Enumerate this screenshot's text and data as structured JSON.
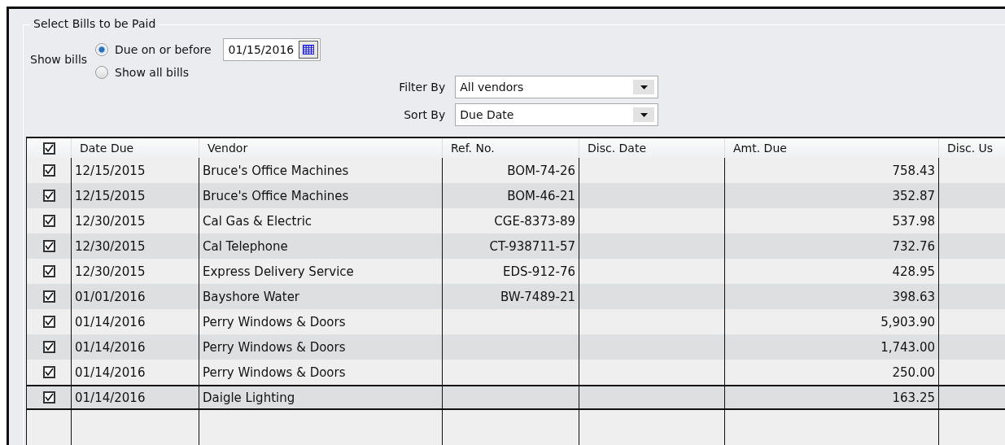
{
  "group_title": "Select Bills to be Paid",
  "show_bills": {
    "label": "Show bills",
    "options": [
      {
        "label": "Due on or before",
        "selected": true
      },
      {
        "label": "Show all bills",
        "selected": false
      }
    ],
    "date": "01/15/2016"
  },
  "filter_by": {
    "label": "Filter By",
    "value": "All vendors"
  },
  "sort_by": {
    "label": "Sort By",
    "value": "Due Date"
  },
  "table": {
    "header_checked": true,
    "columns": [
      "Date Due",
      "Vendor",
      "Ref. No.",
      "Disc. Date",
      "Amt. Due",
      "Disc. Us"
    ],
    "rows": [
      {
        "checked": true,
        "selected": false,
        "date_due": "12/15/2015",
        "vendor": "Bruce's Office Machines",
        "ref_no": "BOM-74-26",
        "amt_due": "758.43"
      },
      {
        "checked": true,
        "selected": false,
        "date_due": "12/15/2015",
        "vendor": "Bruce's Office Machines",
        "ref_no": "BOM-46-21",
        "amt_due": "352.87"
      },
      {
        "checked": true,
        "selected": false,
        "date_due": "12/30/2015",
        "vendor": "Cal Gas & Electric",
        "ref_no": "CGE-8373-89",
        "amt_due": "537.98"
      },
      {
        "checked": true,
        "selected": false,
        "date_due": "12/30/2015",
        "vendor": "Cal Telephone",
        "ref_no": "CT-938711-57",
        "amt_due": "732.76"
      },
      {
        "checked": true,
        "selected": false,
        "date_due": "12/30/2015",
        "vendor": "Express Delivery Service",
        "ref_no": "EDS-912-76",
        "amt_due": "428.95"
      },
      {
        "checked": true,
        "selected": false,
        "date_due": "01/01/2016",
        "vendor": "Bayshore Water",
        "ref_no": "BW-7489-21",
        "amt_due": "398.63"
      },
      {
        "checked": true,
        "selected": false,
        "date_due": "01/14/2016",
        "vendor": "Perry Windows & Doors",
        "amt_due": "5,903.90"
      },
      {
        "checked": true,
        "selected": false,
        "date_due": "01/14/2016",
        "vendor": "Perry Windows & Doors",
        "amt_due": "1,743.00"
      },
      {
        "checked": true,
        "selected": false,
        "date_due": "01/14/2016",
        "vendor": "Perry Windows & Doors",
        "amt_due": "250.00"
      },
      {
        "checked": true,
        "selected": true,
        "date_due": "01/14/2016",
        "vendor": "Daigle Lighting",
        "amt_due": "163.25"
      }
    ]
  }
}
